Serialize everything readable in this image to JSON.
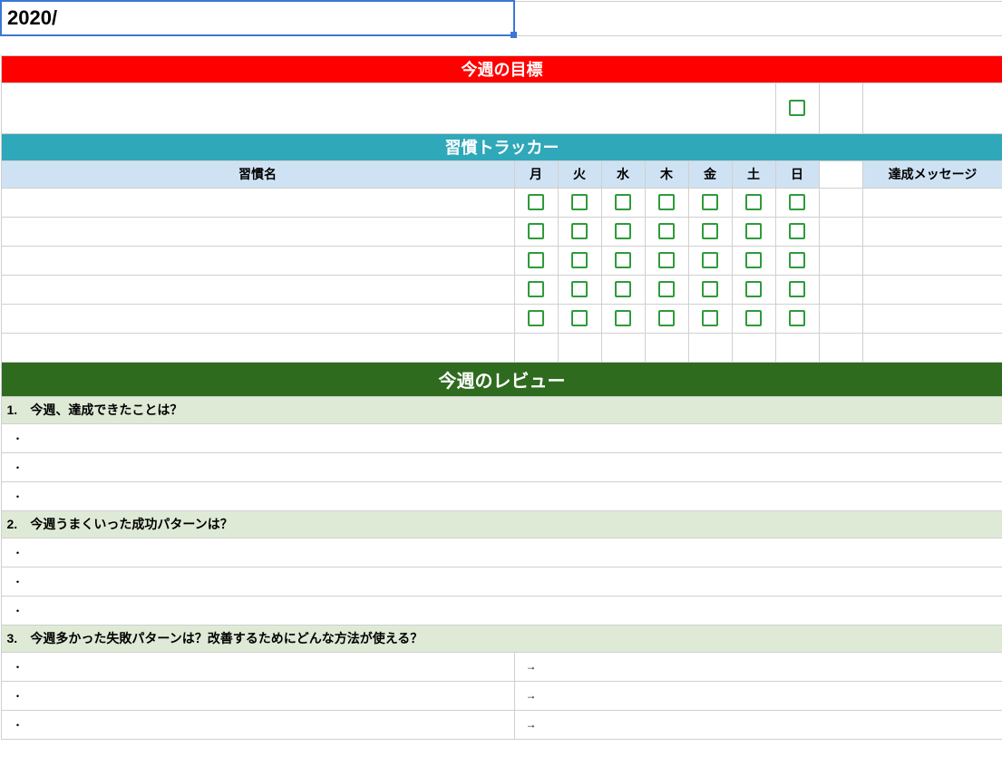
{
  "date_cell": "2020/",
  "banners": {
    "goal": "今週の目標",
    "tracker": "習慣トラッカー",
    "review": "今週のレビュー"
  },
  "tracker": {
    "habit_header": "習慣名",
    "days": [
      "月",
      "火",
      "水",
      "木",
      "金",
      "土",
      "日"
    ],
    "message_header": "達成メッセージ",
    "habit_rows": [
      "",
      "",
      "",
      "",
      ""
    ]
  },
  "review": {
    "questions": [
      {
        "num": "1.",
        "text": "今週、達成できたことは？",
        "answers": [
          "・",
          "・",
          "・"
        ],
        "arrows": false
      },
      {
        "num": "2.",
        "text": "今週うまくいった成功パターンは？",
        "answers": [
          "・",
          "・",
          "・"
        ],
        "arrows": false
      },
      {
        "num": "3.",
        "text": "今週多かった失敗パターンは？改善するためにどんな方法が使える？",
        "answers": [
          "・",
          "・",
          "・"
        ],
        "arrows": true
      }
    ],
    "arrow": "→"
  }
}
